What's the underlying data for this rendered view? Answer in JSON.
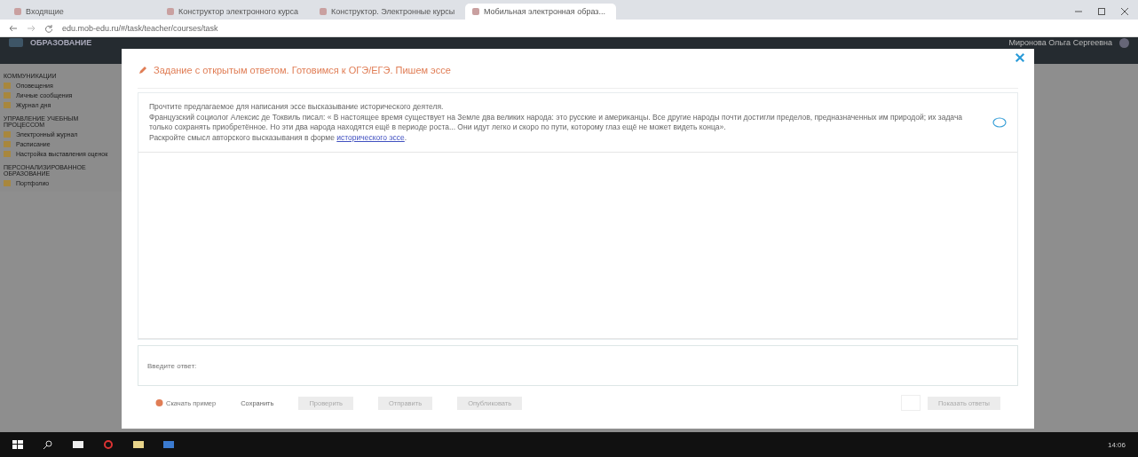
{
  "browser": {
    "tabs": [
      {
        "title": "Входящие",
        "selected": false
      },
      {
        "title": "Конструктор электронного курса",
        "selected": false
      },
      {
        "title": "Конструктор. Электронные курсы",
        "selected": false
      },
      {
        "title": "Мобильная электронная образ...",
        "selected": true
      }
    ],
    "address": "edu.mob-edu.ru/#/task/teacher/courses/task"
  },
  "header": {
    "logo": "ОБРАЗОВАНИЕ",
    "user": "Миронова Ольга Сергеевна"
  },
  "sidebar": {
    "sections": [
      {
        "title": "КОММУНИКАЦИИ",
        "items": [
          "Оповещения",
          "Личные сообщения",
          "Журнал дня"
        ]
      },
      {
        "title": "УПРАВЛЕНИЕ УЧЕБНЫМ ПРОЦЕССОМ",
        "items": [
          "Электронный журнал",
          "Расписание",
          "Настройка выставления оценок"
        ]
      },
      {
        "title": "ПЕРСОНАЛИЗИРОВАННОЕ ОБРАЗОВАНИЕ",
        "items": [
          "Портфолио"
        ]
      }
    ]
  },
  "dialog": {
    "title": "Задание с открытым ответом. Готовимся к ОГЭ/ЕГЭ. Пишем эссе",
    "task": {
      "lines": [
        "Прочтите предлагаемое для написания эссе высказывание исторического деятеля.",
        "Французский социолог Алексис де Токвиль писал: « В настоящее время существует на Земле два великих народа: это русские и американцы. Все другие народы почти достигли пределов, предназначенных им природой; их задача только сохранять приобретённое. Но эти два народа находятся ещё в периоде роста... Они идут легко и скоро по пути, которому глаз ещё не может видеть конца»."
      ],
      "prompt": "Раскройте смысл авторского высказывания в форме ",
      "link": "исторического эссе",
      "after": "."
    },
    "answer": {
      "placeholder": "Введите ответ:"
    },
    "actions": [
      {
        "kind": "link",
        "label": "Скачать пример"
      },
      {
        "kind": "text",
        "label": "Сохранить"
      },
      {
        "kind": "button",
        "label": "Проверить",
        "disabled": true
      },
      {
        "kind": "button",
        "label": "Отправить",
        "disabled": true
      },
      {
        "kind": "button",
        "label": "Опубликовать",
        "disabled": true
      }
    ],
    "submit": {
      "label": "Показать ответы",
      "disabled": true
    }
  },
  "taskbar": {
    "time": "14:06"
  }
}
